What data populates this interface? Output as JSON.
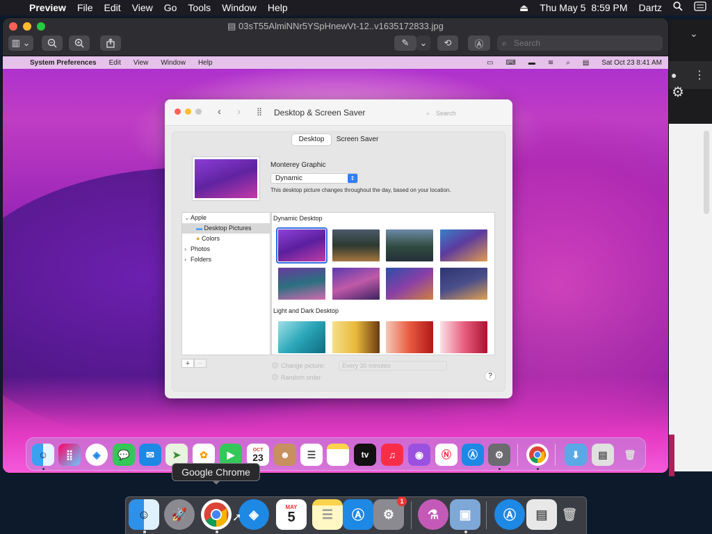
{
  "menubar": {
    "apple": "",
    "app": "Preview",
    "items": [
      "File",
      "Edit",
      "View",
      "Go",
      "Tools",
      "Window",
      "Help"
    ],
    "date": "Thu May 5",
    "time": "8:59 PM",
    "user": "Dartz"
  },
  "preview": {
    "title": "03sT55AlmiNNr5YSpHnewVt-12..v1635172833.jpg",
    "search_placeholder": "Search"
  },
  "screenshot": {
    "menubar": {
      "app": "System Preferences",
      "items": [
        "Edit",
        "View",
        "Window",
        "Help"
      ],
      "datetime": "Sat Oct 23  8:41 AM"
    },
    "prefs": {
      "title": "Desktop & Screen Saver",
      "search_placeholder": "Search",
      "tabs": [
        "Desktop",
        "Screen Saver"
      ],
      "picture_name": "Monterey Graphic",
      "dropdown_value": "Dynamic",
      "description": "This desktop picture changes throughout the day, based on your location.",
      "sidebar": [
        {
          "label": "Apple",
          "arrow": "⌄"
        },
        {
          "label": "Desktop Pictures",
          "arrow": ""
        },
        {
          "label": "Colors",
          "arrow": ""
        },
        {
          "label": "Photos",
          "arrow": "›"
        },
        {
          "label": "Folders",
          "arrow": "›"
        }
      ],
      "section_dynamic": "Dynamic Desktop",
      "section_light_dark": "Light and Dark Desktop",
      "add": "+",
      "remove": "−",
      "change_picture": "Change picture:",
      "interval": "Every 30 minutes",
      "random_order": "Random order",
      "help": "?"
    },
    "dock_calendar_month": "OCT",
    "dock_calendar_day": "23",
    "dock_tv_label": "tv"
  },
  "tooltip": "Google Chrome",
  "dock": {
    "calendar_month": "MAY",
    "calendar_day": "5",
    "settings_badge": "1"
  }
}
